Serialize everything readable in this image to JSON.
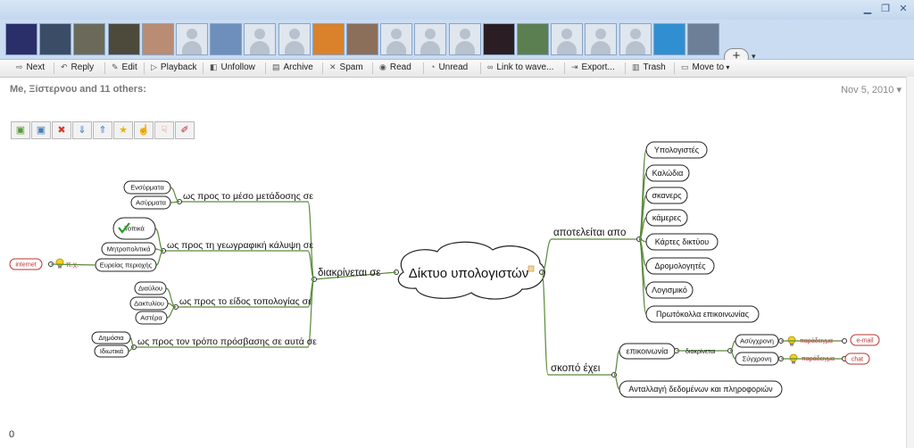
{
  "window": {
    "controls": [
      "minimize-icon",
      "restore-icon",
      "close-icon"
    ]
  },
  "avatars": [
    {
      "kind": "photo",
      "color": "#2a2f6a"
    },
    {
      "kind": "photo",
      "color": "#3b4d66"
    },
    {
      "kind": "photo",
      "color": "#6b6a5a"
    },
    {
      "kind": "photo",
      "color": "#4d4a3b"
    },
    {
      "kind": "photo",
      "color": "#b98c73"
    },
    {
      "kind": "person"
    },
    {
      "kind": "photo",
      "color": "#6e8fbc"
    },
    {
      "kind": "person"
    },
    {
      "kind": "person"
    },
    {
      "kind": "photo",
      "color": "#d9822b"
    },
    {
      "kind": "photo",
      "color": "#8b6f5a"
    },
    {
      "kind": "person"
    },
    {
      "kind": "person"
    },
    {
      "kind": "person"
    },
    {
      "kind": "photo",
      "color": "#2a1e24"
    },
    {
      "kind": "photo",
      "color": "#5c7f52"
    },
    {
      "kind": "person"
    },
    {
      "kind": "person"
    },
    {
      "kind": "person"
    },
    {
      "kind": "photo",
      "color": "#2f8fd0"
    },
    {
      "kind": "photo",
      "color": "#6c7f96"
    }
  ],
  "add_participant": {
    "label": "+",
    "dropdown": "▾"
  },
  "toolbar": [
    {
      "label": "Next",
      "icon": "arrow-right-icon",
      "glyph": "⇨"
    },
    {
      "label": "Reply",
      "icon": "reply-icon",
      "glyph": "↶"
    },
    {
      "label": "Edit",
      "icon": "pencil-icon",
      "glyph": "✎"
    },
    {
      "label": "Playback",
      "icon": "play-icon",
      "glyph": "▷"
    },
    {
      "label": "Unfollow",
      "icon": "mute-icon",
      "glyph": "◧"
    },
    {
      "label": "Archive",
      "icon": "archive-icon",
      "glyph": "▤"
    },
    {
      "label": "Spam",
      "icon": "spam-icon",
      "glyph": "✕"
    },
    {
      "label": "Read",
      "icon": "eye-icon",
      "glyph": "◉"
    },
    {
      "label": "Unread",
      "icon": "unread-icon",
      "glyph": "◔"
    },
    {
      "label": "Link to wave...",
      "icon": "link-icon",
      "glyph": "∞"
    },
    {
      "label": "Export...",
      "icon": "export-icon",
      "glyph": "⇥"
    },
    {
      "label": "Trash",
      "icon": "trash-icon",
      "glyph": "▥"
    },
    {
      "label": "Move to",
      "icon": "folder-icon",
      "glyph": "▭",
      "dropdown": "▾"
    }
  ],
  "wave": {
    "participants": "Me, Ξίστερνου and 11 others:",
    "date": "Nov 5, 2010",
    "date_dropdown": "▾",
    "blip_count": "0"
  },
  "mindmap_tools": [
    {
      "name": "add-child-icon",
      "glyph": "▣",
      "color": "#5a9a3a"
    },
    {
      "name": "add-sibling-icon",
      "glyph": "▣",
      "color": "#4a7fb8"
    },
    {
      "name": "delete-node-icon",
      "glyph": "✖",
      "color": "#d23a2a"
    },
    {
      "name": "move-down-icon",
      "glyph": "⇓",
      "color": "#3f79c8"
    },
    {
      "name": "move-up-icon",
      "glyph": "⇑",
      "color": "#3f79c8"
    },
    {
      "name": "star-icon",
      "glyph": "★",
      "color": "#e8b400"
    },
    {
      "name": "thumbs-up-icon",
      "glyph": "☝",
      "color": "#e08a2a"
    },
    {
      "name": "thumbs-down-icon",
      "glyph": "☟",
      "color": "#d86a3a"
    },
    {
      "name": "marker-icon",
      "glyph": "✐",
      "color": "#c02020"
    }
  ],
  "mindmap": {
    "root": "Δίκτυο υπολογιστών",
    "left_branch": "διακρίνεται σε",
    "left_groups": [
      {
        "label": "ως προς το μέσο μετάδοσης σε",
        "children": [
          "Ενσύρματα",
          "Ασύρματα"
        ]
      },
      {
        "label": "ως προς τη γεωγραφική κάλυψη σε",
        "children": [
          "Τοπικά",
          "Μητροπολιτικά",
          "Ευρείας περιοχής"
        ]
      },
      {
        "label": "ως προς το είδος τοπολογίας σε",
        "children": [
          "Διαύλου",
          "Δακτυλίου",
          "Αστέρα"
        ]
      },
      {
        "label": "ως προς τον τρόπο πρόσβασης σε αυτά σε",
        "children": [
          "Δημόσια",
          "Ιδιωτικά"
        ]
      }
    ],
    "example_label": "π.χ.",
    "example_value": "internet",
    "right_top_branch": "αποτελείται απο",
    "components": [
      "Υπολογιστές",
      "Καλώδια",
      "σκανερς",
      "κάμερες",
      "Κάρτες δικτύου",
      "Δρομολογητές",
      "Λογισμικό",
      "Πρωτόκολλα επικοινωνίας"
    ],
    "right_bottom_branch": "σκοπό έχει",
    "purpose_1": "επικοινωνία",
    "purpose_1_link": "διακρίνεται",
    "comm_types": [
      {
        "label": "Ασύγχρονη",
        "example_label": "παράδειγμα",
        "example_value": "e-mail"
      },
      {
        "label": "Σύγχρονη",
        "example_label": "παράδειγμα",
        "example_value": "chat"
      }
    ],
    "purpose_2": "Ανταλλαγή δεδομένων και πληροφοριών"
  }
}
